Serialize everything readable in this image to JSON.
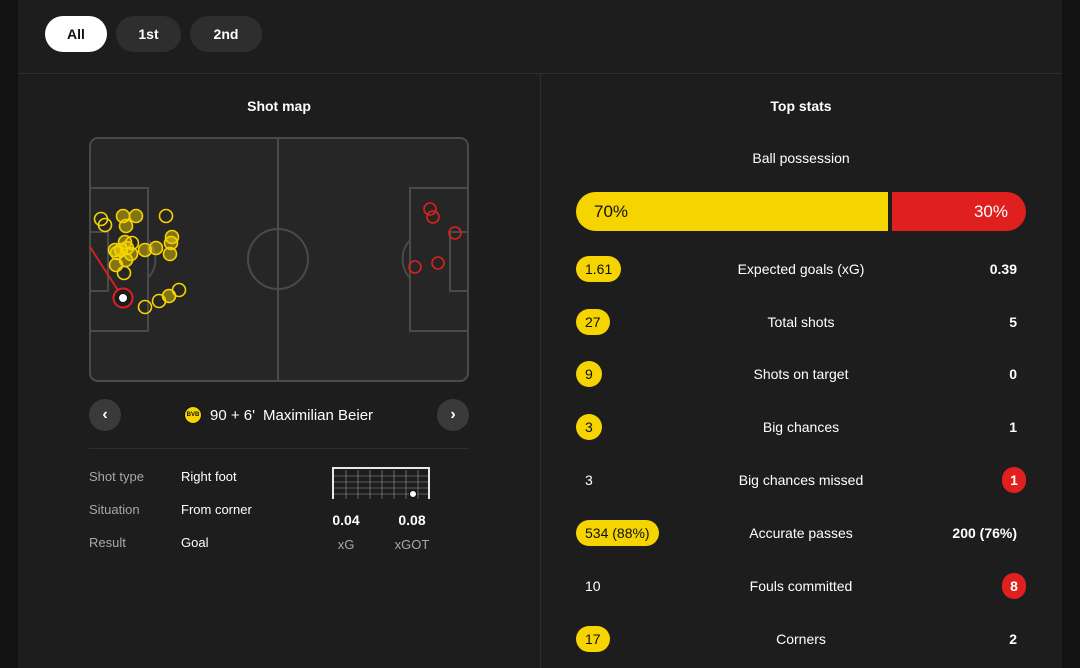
{
  "tabs": [
    {
      "label": "All",
      "active": true
    },
    {
      "label": "1st",
      "active": false
    },
    {
      "label": "2nd",
      "active": false
    }
  ],
  "shot_map": {
    "title": "Shot map",
    "selected_shot": {
      "minute": "90 + 6'",
      "player": "Maximilian Beier",
      "club_badge_text": "BVB"
    },
    "details": [
      {
        "label": "Shot type",
        "value": "Right foot"
      },
      {
        "label": "Situation",
        "value": "From corner"
      },
      {
        "label": "Result",
        "value": "Goal"
      }
    ],
    "xg": {
      "value": "0.04",
      "label": "xG"
    },
    "xgot": {
      "value": "0.08",
      "label": "xGOT"
    },
    "prev_icon": "chevron-left-icon",
    "next_icon": "chevron-right-icon",
    "colors": {
      "home": "#f5d400",
      "away": "#e0201e"
    }
  },
  "top_stats": {
    "title": "Top stats",
    "possession": {
      "label": "Ball possession",
      "home": "70%",
      "away": "30%",
      "home_share": 0.7
    },
    "rows": [
      {
        "label": "Expected goals (xG)",
        "home": "1.61",
        "away": "0.39",
        "highlight": "home"
      },
      {
        "label": "Total shots",
        "home": "27",
        "away": "5",
        "highlight": "home"
      },
      {
        "label": "Shots on target",
        "home": "9",
        "away": "0",
        "highlight": "home"
      },
      {
        "label": "Big chances",
        "home": "3",
        "away": "1",
        "highlight": "home"
      },
      {
        "label": "Big chances missed",
        "home": "3",
        "away": "1",
        "highlight": "away"
      },
      {
        "label": "Accurate passes",
        "home": "534 (88%)",
        "away": "200 (76%)",
        "highlight": "home"
      },
      {
        "label": "Fouls committed",
        "home": "10",
        "away": "8",
        "highlight": "away"
      },
      {
        "label": "Corners",
        "home": "17",
        "away": "2",
        "highlight": "home"
      }
    ]
  }
}
